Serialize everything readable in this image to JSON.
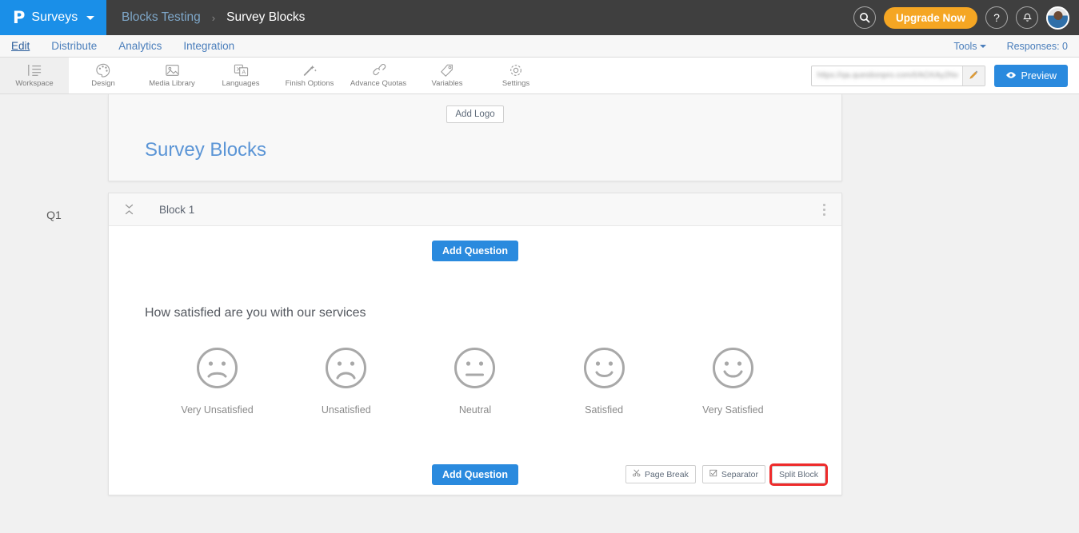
{
  "topbar": {
    "brand_logo": "P",
    "brand_name": "Surveys",
    "breadcrumb": {
      "parent": "Blocks Testing",
      "separator": "›",
      "current": "Survey Blocks"
    },
    "search_icon": "search-icon",
    "upgrade_label": "Upgrade Now",
    "help_icon": "?",
    "bell_icon": "•",
    "avatar": "user-avatar",
    "colors": {
      "brand_blue": "#1a8fe8",
      "bar_gray": "#3f3f3f",
      "upgrade_orange": "#f5a623"
    }
  },
  "navrow": {
    "tabs": [
      {
        "label": "Edit",
        "active": true
      },
      {
        "label": "Distribute",
        "active": false
      },
      {
        "label": "Analytics",
        "active": false
      },
      {
        "label": "Integration",
        "active": false
      }
    ],
    "tools_label": "Tools",
    "responses_label": "Responses: 0"
  },
  "toolbar": {
    "items": [
      {
        "label": "Workspace",
        "icon": "workspace-icon",
        "active": true
      },
      {
        "label": "Design",
        "icon": "palette-icon",
        "active": false
      },
      {
        "label": "Media Library",
        "icon": "image-icon",
        "active": false
      },
      {
        "label": "Languages",
        "icon": "translate-icon",
        "active": false
      },
      {
        "label": "Finish Options",
        "icon": "magic-wand-icon",
        "active": false
      },
      {
        "label": "Advance Quotas",
        "icon": "link-chain-icon",
        "active": false
      },
      {
        "label": "Variables",
        "icon": "tag-icon",
        "active": false
      },
      {
        "label": "Settings",
        "icon": "gear-icon",
        "active": false
      }
    ],
    "url_value": "https://qa.questionpro.com/t/AOXAy2Nv",
    "url_blurred": true,
    "edit_icon": "pencil-icon",
    "preview_label": "Preview",
    "preview_icon": "eye-icon"
  },
  "main": {
    "question_gutter_label": "Q1",
    "title_card": {
      "add_logo_label": "Add Logo",
      "survey_title": "Survey Blocks"
    },
    "block": {
      "collapse_icon": "collapse-icon",
      "name": "Block 1",
      "menu_icon": "kebab-menu-icon",
      "add_question_top": "Add Question",
      "add_question_bottom": "Add Question",
      "question": {
        "text": "How satisfied are you with our services",
        "type": "smiley-rating-scale",
        "options": [
          {
            "label": "Very Unsatisfied",
            "face": "frown"
          },
          {
            "label": "Unsatisfied",
            "face": "deep-frown"
          },
          {
            "label": "Neutral",
            "face": "neutral"
          },
          {
            "label": "Satisfied",
            "face": "smile"
          },
          {
            "label": "Very Satisfied",
            "face": "big-smile"
          }
        ]
      },
      "footer_buttons": [
        {
          "label": "Page Break",
          "icon": "scissors-icon",
          "highlighted": false
        },
        {
          "label": "Separator",
          "icon": "checkbox-icon",
          "highlighted": false
        },
        {
          "label": "Split Block",
          "icon": "none",
          "highlighted": true
        }
      ],
      "highlight_color": "#ee2b2b"
    }
  }
}
